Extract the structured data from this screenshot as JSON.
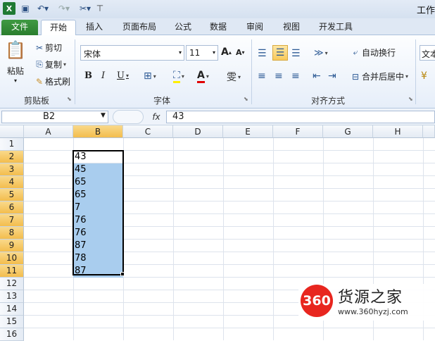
{
  "app": {
    "title": "工作"
  },
  "qat": {
    "icons": [
      "excel-logo-icon",
      "save-icon",
      "undo-icon",
      "redo-icon",
      "customize-icon"
    ]
  },
  "tabs": [
    "文件",
    "开始",
    "插入",
    "页面布局",
    "公式",
    "数据",
    "审阅",
    "视图",
    "开发工具"
  ],
  "ribbon": {
    "clipboard": {
      "label": "剪贴板",
      "paste": "粘贴",
      "cut": "剪切",
      "copy": "复制",
      "format_painter": "格式刷"
    },
    "font": {
      "label": "字体",
      "name": "宋体",
      "size": "11",
      "bold": "B",
      "italic": "I",
      "underline": "U",
      "grow": "A",
      "shrink": "A"
    },
    "alignment": {
      "label": "对齐方式",
      "wrap": "自动换行",
      "merge": "合并后居中"
    },
    "number": {
      "format": "文本"
    }
  },
  "formula_bar": {
    "name_box": "B2",
    "fx": "fx",
    "value": "43"
  },
  "columns": [
    "A",
    "B",
    "C",
    "D",
    "E",
    "F",
    "G",
    "H"
  ],
  "rows": [
    "1",
    "2",
    "3",
    "4",
    "5",
    "6",
    "7",
    "8",
    "9",
    "10",
    "11",
    "12",
    "13",
    "14",
    "15",
    "16"
  ],
  "cells": {
    "B2": "43",
    "B3": "45",
    "B4": "65",
    "B5": "65",
    "B6": "7",
    "B7": "76",
    "B8": "76",
    "B9": "87",
    "B10": "78",
    "B11": "87"
  },
  "colors": {
    "selection": "#a9cdee",
    "header_highlight": "#f3bd4d",
    "file_tab": "#2a7d2e"
  },
  "watermark": {
    "logo": "360",
    "name": "货源之家",
    "url": "www.360hyzj.com"
  }
}
